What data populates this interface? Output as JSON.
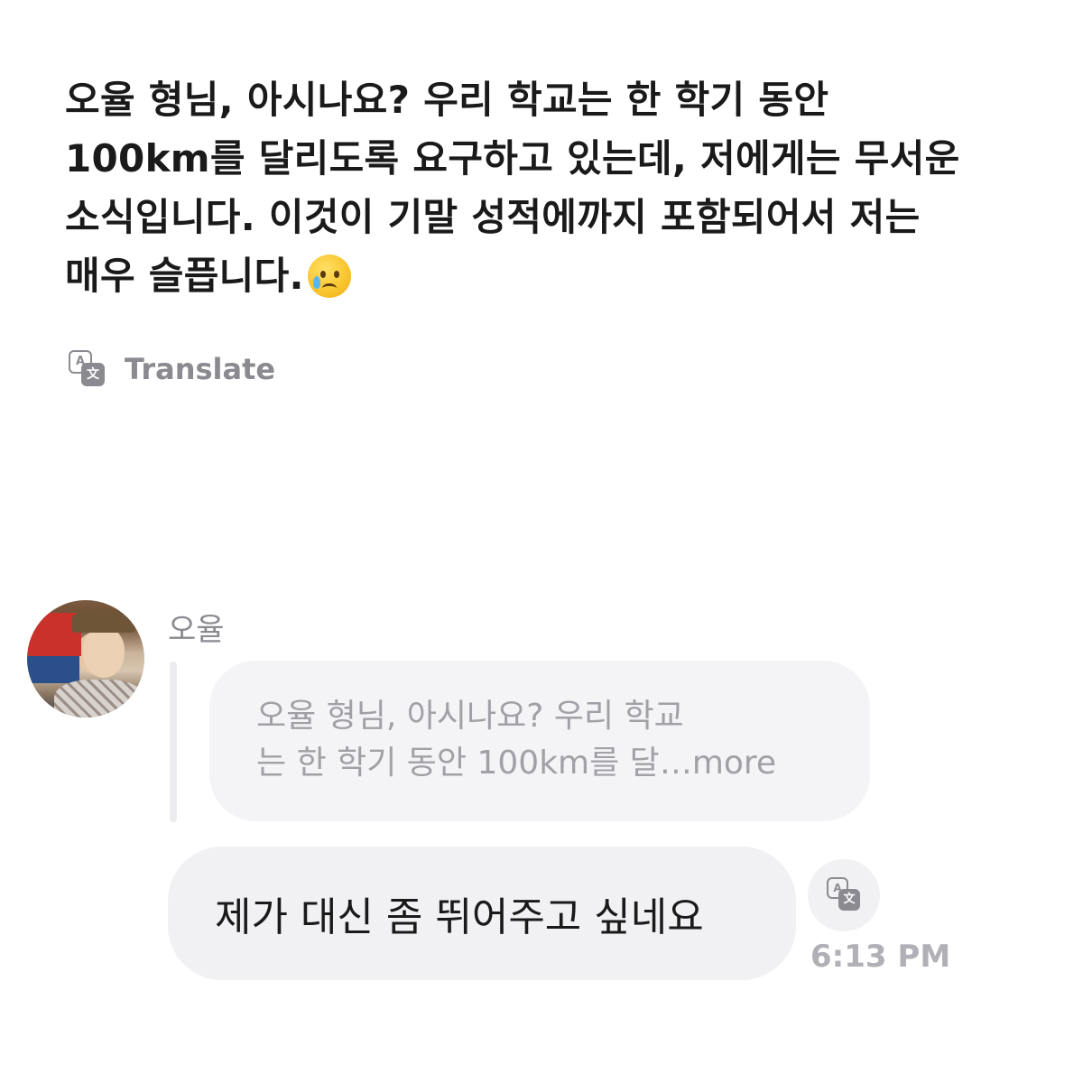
{
  "post": {
    "lines": [
      "오율 형님, 아시나요? 우리 학교는 한 학기 동안",
      "100km를 달리도록 요구하고 있는데, 저에게는 무서운",
      "소식입니다. 이것이 기말 성적에까지 포함되어서 저는",
      "매우 슬픕니다."
    ],
    "emoji": "crying-face"
  },
  "translate": {
    "label": "Translate",
    "icon": "translate-icon"
  },
  "reply": {
    "sender": "오율",
    "avatar": "profile-photo",
    "quote_lines": [
      "오율 형님, 아시나요? 우리 학교",
      "는 한 학기 동안 100km를 달"
    ],
    "quote_ellipsis": "…",
    "quote_more": "more",
    "message": "제가 대신 좀 뛰어주고 싶네요",
    "time": "6:13 PM"
  }
}
